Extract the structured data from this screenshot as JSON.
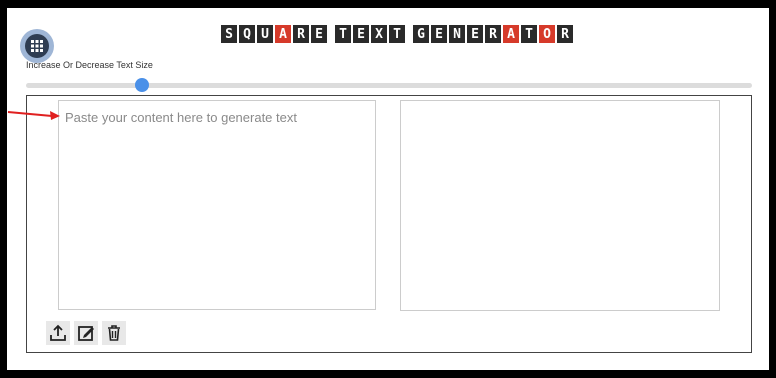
{
  "header": {
    "title_tiles": [
      {
        "char": "S",
        "accent": false
      },
      {
        "char": "Q",
        "accent": false
      },
      {
        "char": "U",
        "accent": false
      },
      {
        "char": "A",
        "accent": true
      },
      {
        "char": "R",
        "accent": false
      },
      {
        "char": "E",
        "accent": false
      },
      {
        "char": " ",
        "accent": false
      },
      {
        "char": "T",
        "accent": false
      },
      {
        "char": "E",
        "accent": false
      },
      {
        "char": "X",
        "accent": false
      },
      {
        "char": "T",
        "accent": false
      },
      {
        "char": " ",
        "accent": false
      },
      {
        "char": "G",
        "accent": false
      },
      {
        "char": "E",
        "accent": false
      },
      {
        "char": "N",
        "accent": false
      },
      {
        "char": "E",
        "accent": false
      },
      {
        "char": "R",
        "accent": false
      },
      {
        "char": "A",
        "accent": true
      },
      {
        "char": "T",
        "accent": false
      },
      {
        "char": "O",
        "accent": true
      },
      {
        "char": "R",
        "accent": false
      }
    ],
    "tile_color": "#2a2a2a",
    "accent_color": "#d63a2a"
  },
  "menu": {
    "icon": "grid-menu-icon"
  },
  "size_control": {
    "label": "Increase Or Decrease Text Size",
    "value_fraction": 0.16
  },
  "editor": {
    "input_placeholder": "Paste your content here to generate text",
    "output_text": ""
  },
  "toolbar": {
    "buttons": [
      {
        "name": "upload",
        "icon": "upload-icon"
      },
      {
        "name": "edit",
        "icon": "edit-icon"
      },
      {
        "name": "delete",
        "icon": "trash-icon"
      }
    ]
  },
  "colors": {
    "slider_thumb": "#4a90e8",
    "annotation_arrow": "#e02020"
  }
}
